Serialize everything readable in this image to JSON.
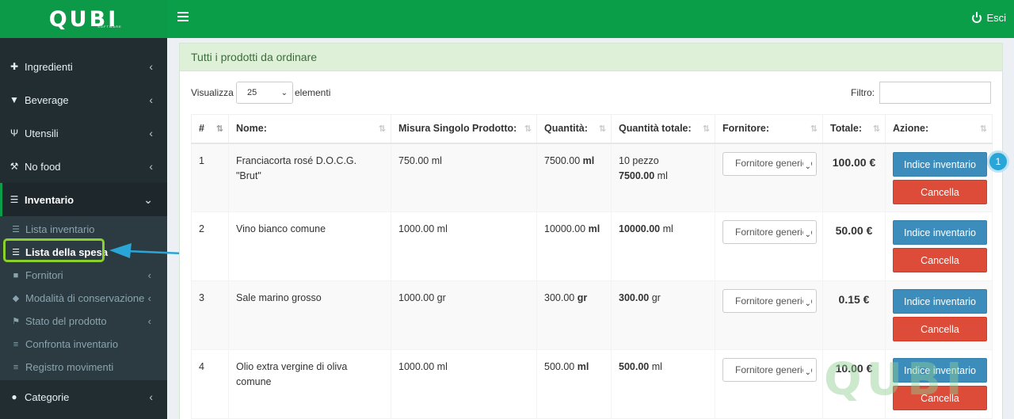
{
  "brand": {
    "logo": "QUBI",
    "sub": "SOFTWARE"
  },
  "topbar": {
    "logout_label": "Esci"
  },
  "sidebar": {
    "items": [
      {
        "label": "Ingredienti",
        "icon": "puzzle-icon"
      },
      {
        "label": "Beverage",
        "icon": "filter-glass-icon"
      },
      {
        "label": "Utensili",
        "icon": "cutlery-icon"
      },
      {
        "label": "No food",
        "icon": "wrench-icon"
      },
      {
        "label": "Inventario",
        "icon": "list-icon"
      }
    ],
    "subitems": [
      {
        "label": "Lista inventario",
        "icon": "list-icon"
      },
      {
        "label": "Lista della spesa",
        "icon": "list-ul-icon"
      },
      {
        "label": "Fornitori",
        "icon": "truck-icon"
      },
      {
        "label": "Modalità di conservazione",
        "icon": "cube-icon"
      },
      {
        "label": "Stato del prodotto",
        "icon": "flag-icon"
      },
      {
        "label": "Confronta inventario",
        "icon": "bars-icon"
      },
      {
        "label": "Registro movimenti",
        "icon": "bars-icon"
      }
    ],
    "footer_item": {
      "label": "Categorie",
      "icon": "info-circle-icon"
    }
  },
  "panel": {
    "title": "Tutti i prodotti da ordinare",
    "show_label": "Visualizza",
    "show_value": "25",
    "elements_label": "elementi",
    "filter_label": "Filtro:",
    "columns": [
      "#",
      "Nome:",
      "Misura Singolo Prodotto:",
      "Quantità:",
      "Quantità totale:",
      "Fornitore:",
      "Totale:",
      "Azione:"
    ],
    "rows": [
      {
        "n": "1",
        "name": "Franciacorta rosé D.O.C.G. \"Brut\"",
        "measure": "750.00 ml",
        "qty": "7500.00",
        "qty_unit": "ml",
        "total_qty_a": "10 pezzo",
        "total_qty_b": "7500.00",
        "total_qty_b_unit": "ml",
        "supplier": "Fornitore generico",
        "total": "100.00 €"
      },
      {
        "n": "2",
        "name": "Vino bianco comune",
        "measure": "1000.00 ml",
        "qty": "10000.00",
        "qty_unit": "ml",
        "total_qty_a": "",
        "total_qty_b": "10000.00",
        "total_qty_b_unit": "ml",
        "supplier": "Fornitore generico",
        "total": "50.00 €"
      },
      {
        "n": "3",
        "name": "Sale marino grosso",
        "measure": "1000.00 gr",
        "qty": "300.00",
        "qty_unit": "gr",
        "total_qty_a": "",
        "total_qty_b": "300.00",
        "total_qty_b_unit": "gr",
        "supplier": "Fornitore generico",
        "total": "0.15 €"
      },
      {
        "n": "4",
        "name": "Olio extra vergine di oliva comune",
        "measure": "1000.00 ml",
        "qty": "500.00",
        "qty_unit": "ml",
        "total_qty_a": "",
        "total_qty_b": "500.00",
        "total_qty_b_unit": "ml",
        "supplier": "Fornitore generico",
        "total": "10.00 €"
      }
    ],
    "btn_inventory": "Indice inventario",
    "btn_delete": "Cancella"
  },
  "annotation": {
    "badge": "1"
  },
  "watermark": "QUBI",
  "colors": {
    "green": "#0a9e49",
    "sidebar": "#222d32",
    "blue_btn": "#3c8dbc",
    "red_btn": "#dd4b39",
    "highlight": "#8bd02b",
    "arrow": "#2aa5d8"
  }
}
